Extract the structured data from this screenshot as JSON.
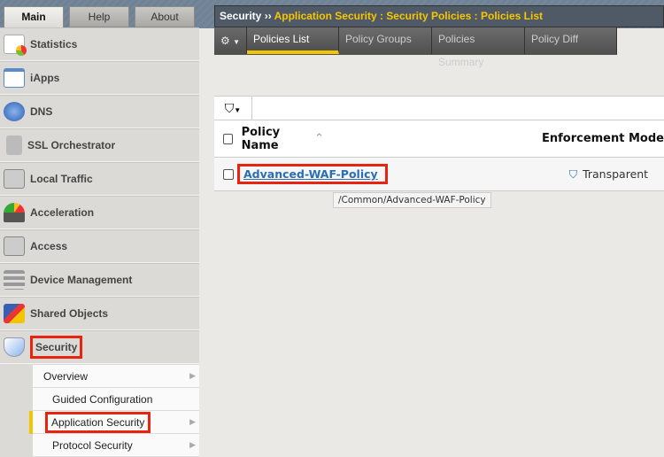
{
  "nav_tabs": [
    "Main",
    "Help",
    "About"
  ],
  "sidebar": {
    "items": [
      {
        "label": "Statistics",
        "icon": "statistics-icon"
      },
      {
        "label": "iApps",
        "icon": "iapps-icon"
      },
      {
        "label": "DNS",
        "icon": "dns-globe-icon"
      },
      {
        "label": "SSL Orchestrator",
        "icon": "ssl-lock-icon"
      },
      {
        "label": "Local Traffic",
        "icon": "local-traffic-icon"
      },
      {
        "label": "Acceleration",
        "icon": "acceleration-gauge-icon"
      },
      {
        "label": "Access",
        "icon": "access-icon"
      },
      {
        "label": "Device Management",
        "icon": "device-management-icon"
      },
      {
        "label": "Shared Objects",
        "icon": "shared-objects-icon"
      },
      {
        "label": "Security",
        "icon": "security-shield-icon"
      }
    ],
    "submenu": [
      "Overview",
      "Guided Configuration",
      "Application Security",
      "Protocol Security"
    ]
  },
  "breadcrumb": {
    "root": "Security",
    "separator": "››",
    "path": "Application Security : Security Policies : Policies List"
  },
  "tabs": [
    "Policies List",
    "Policy Groups",
    "Policies Summary",
    "Policy Diff"
  ],
  "table": {
    "columns": [
      "Policy Name",
      "Enforcement Mode"
    ],
    "rows": [
      {
        "name": "Advanced-WAF-Policy",
        "mode": "Transparent"
      }
    ],
    "tooltip": "/Common/Advanced-WAF-Policy"
  }
}
